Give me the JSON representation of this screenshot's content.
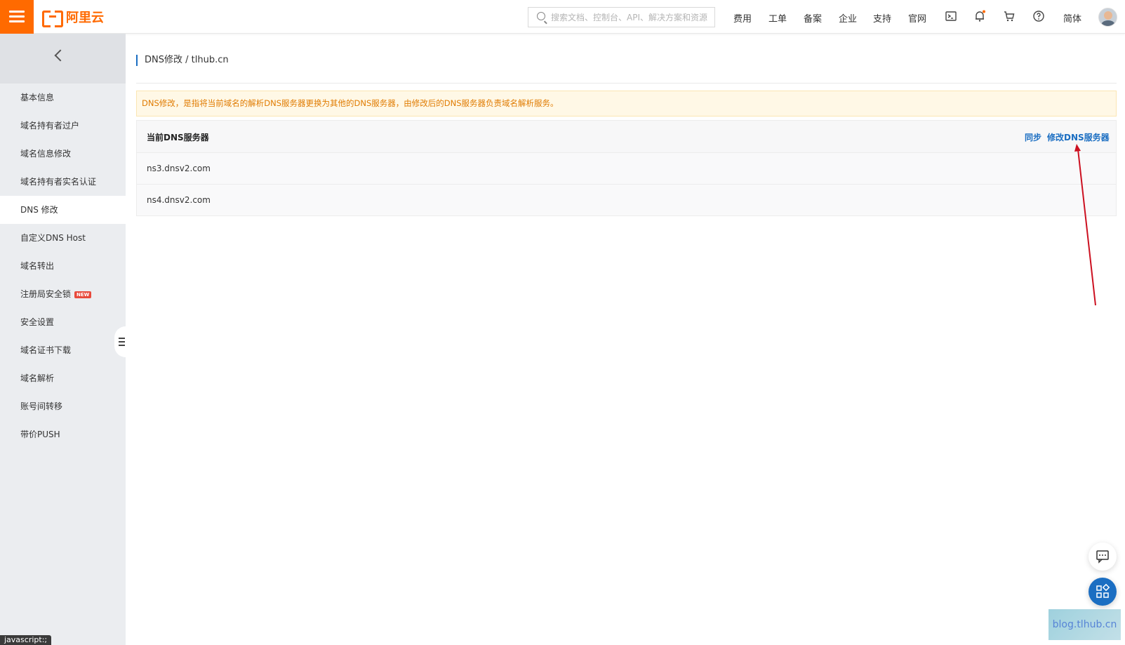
{
  "header": {
    "logo_text": "阿里云",
    "search_placeholder": "搜索文档、控制台、API、解决方案和资源",
    "nav": [
      "费用",
      "工单",
      "备案",
      "企业",
      "支持",
      "官网"
    ],
    "language": "简体"
  },
  "sidebar": {
    "items": [
      {
        "label": "基本信息"
      },
      {
        "label": "域名持有者过户"
      },
      {
        "label": "域名信息修改"
      },
      {
        "label": "域名持有者实名认证"
      },
      {
        "label": "DNS 修改",
        "active": true
      },
      {
        "label": "自定义DNS Host"
      },
      {
        "label": "域名转出"
      },
      {
        "label": "注册局安全锁",
        "badge": "NEW"
      },
      {
        "label": "安全设置"
      },
      {
        "label": "域名证书下载"
      },
      {
        "label": "域名解析"
      },
      {
        "label": "账号间转移"
      },
      {
        "label": "带价PUSH"
      }
    ]
  },
  "main": {
    "breadcrumb": "DNS修改 / tlhub.cn",
    "notice": "DNS修改，是指将当前域名的解析DNS服务器更换为其他的DNS服务器，由修改后的DNS服务器负责域名解析服务。",
    "dns_table": {
      "title": "当前DNS服务器",
      "sync_label": "同步",
      "modify_label": "修改DNS服务器",
      "servers": [
        "ns3.dnsv2.com",
        "ns4.dnsv2.com"
      ]
    }
  },
  "watermark": "blog.tlhub.cn",
  "status_text": "javascript:;",
  "colors": {
    "brand": "#ff6a00",
    "link": "#1b6ec2",
    "notice_text": "#e07b00",
    "arrow": "#cc1020"
  }
}
